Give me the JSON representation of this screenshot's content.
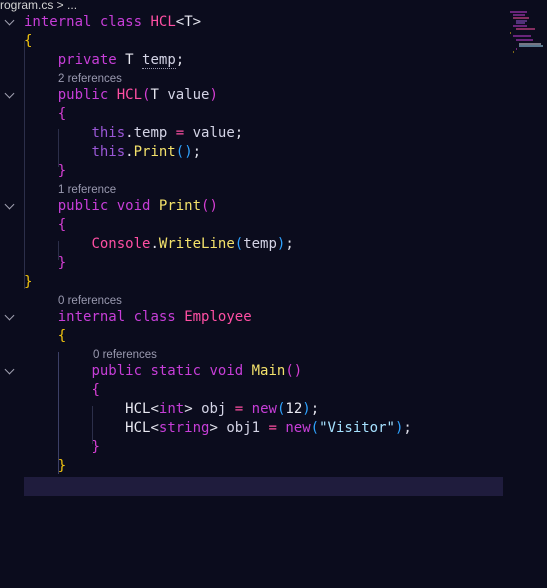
{
  "breadcrumb": {
    "text": "rogram.cs > ..."
  },
  "lenses": {
    "hcl_ctor": "2 references",
    "print": "1 reference",
    "employee": "0 references",
    "main": "0 references"
  },
  "code": {
    "l1": [
      "internal",
      "class",
      "HCL",
      "<",
      "T",
      ">"
    ],
    "l3": [
      "private",
      "T",
      "temp",
      ";"
    ],
    "l4": [
      "public",
      "HCL",
      "(",
      "T",
      "value",
      ")"
    ],
    "l6": [
      "this",
      ".",
      "temp",
      "=",
      "value",
      ";"
    ],
    "l7": [
      "this",
      ".",
      "Print",
      "(",
      ")",
      ";"
    ],
    "l9": [
      "public",
      "void",
      "Print",
      "(",
      ")"
    ],
    "l11": [
      "Console",
      ".",
      "WriteLine",
      "(",
      "temp",
      ")",
      ";"
    ],
    "l14": [
      "internal",
      "class",
      "Employee"
    ],
    "l16": [
      "public",
      "static",
      "void",
      "Main",
      "(",
      ")"
    ],
    "l18": [
      "HCL",
      "<",
      "int",
      ">",
      "obj",
      "=",
      "new",
      "(",
      "12",
      ")",
      ";"
    ],
    "l19": [
      "HCL",
      "<",
      "string",
      ">",
      "obj1",
      "=",
      "new",
      "(",
      "\"Visitor\"",
      ")",
      ";"
    ],
    "brace_open": "{",
    "brace_close": "}"
  },
  "colors": {
    "background": "#0b0c1d",
    "keyword": "#c73ed8",
    "class_name": "#ff4fa3",
    "brace": "#f1c40f",
    "method": "#f4e26b",
    "paren": "#2fa3ff",
    "string": "#a6e2ff"
  }
}
